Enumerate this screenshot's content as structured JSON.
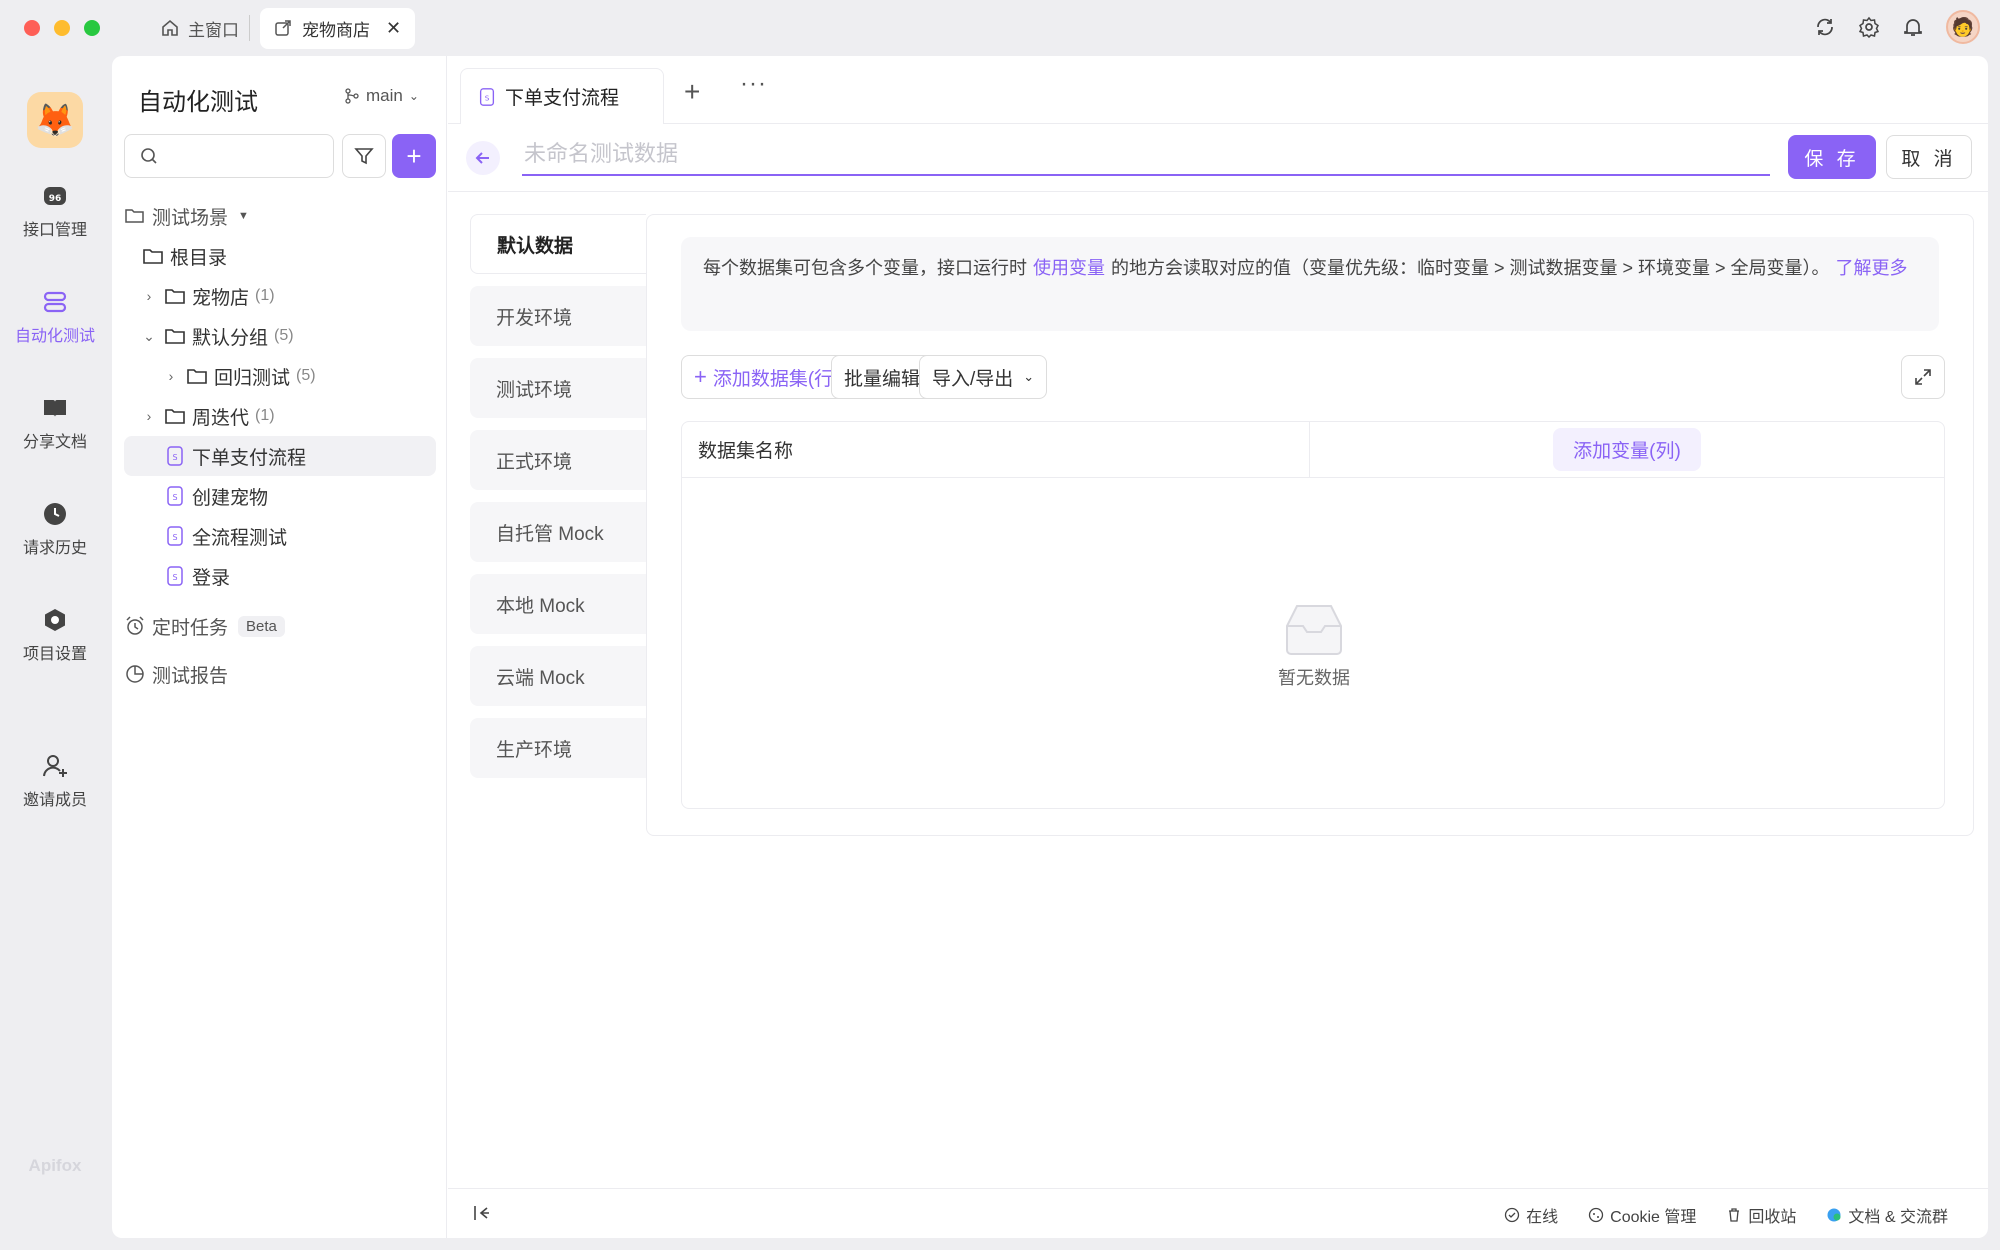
{
  "titlebar": {
    "home_tab": "主窗口",
    "active_tab": "宠物商店"
  },
  "rail": {
    "items": [
      {
        "label": "接口管理",
        "icon": "api-icon"
      },
      {
        "label": "自动化测试",
        "icon": "automation-icon",
        "active": true
      },
      {
        "label": "分享文档",
        "icon": "book-icon"
      },
      {
        "label": "请求历史",
        "icon": "clock-icon"
      },
      {
        "label": "项目设置",
        "icon": "settings-icon"
      },
      {
        "label": "邀请成员",
        "icon": "invite-icon"
      }
    ],
    "brand": "Apifox"
  },
  "sidebar": {
    "title": "自动化测试",
    "branch": "main",
    "tree": {
      "scenes": "测试场景",
      "root": "根目录",
      "pet_store": "宠物店",
      "pet_store_count": "(1)",
      "default_group": "默认分组",
      "default_group_count": "(5)",
      "regression": "回归测试",
      "regression_count": "(5)",
      "iteration": "周迭代",
      "iteration_count": "(1)",
      "order_flow": "下单支付流程",
      "create_pet": "创建宠物",
      "full_flow": "全流程测试",
      "login": "登录",
      "scheduled": "定时任务",
      "beta": "Beta",
      "report": "测试报告"
    }
  },
  "editor": {
    "tab_label": "下单支付流程",
    "name_placeholder": "未命名测试数据",
    "save": "保 存",
    "cancel": "取 消"
  },
  "environments": [
    "默认数据",
    "开发环境",
    "测试环境",
    "正式环境",
    "自托管 Mock",
    "本地 Mock",
    "云端 Mock",
    "生产环境"
  ],
  "info": {
    "text_a": "每个数据集可包含多个变量，接口运行时",
    "link_a": "使用变量",
    "text_b": "的地方会读取对应的值（变量优先级：临时变量 > 测试数据变量 > 环境变量 > 全局变量）。",
    "link_b": "了解更多"
  },
  "actions": {
    "add_dataset": "添加数据集(行)",
    "batch_edit": "批量编辑",
    "import_export": "导入/导出"
  },
  "grid": {
    "col_name": "数据集名称",
    "add_var": "添加变量(列)",
    "empty": "暂无数据"
  },
  "footer": {
    "online": "在线",
    "cookie": "Cookie 管理",
    "trash": "回收站",
    "docs": "文档 & 交流群"
  },
  "colors": {
    "accent": "#8a63f5"
  }
}
